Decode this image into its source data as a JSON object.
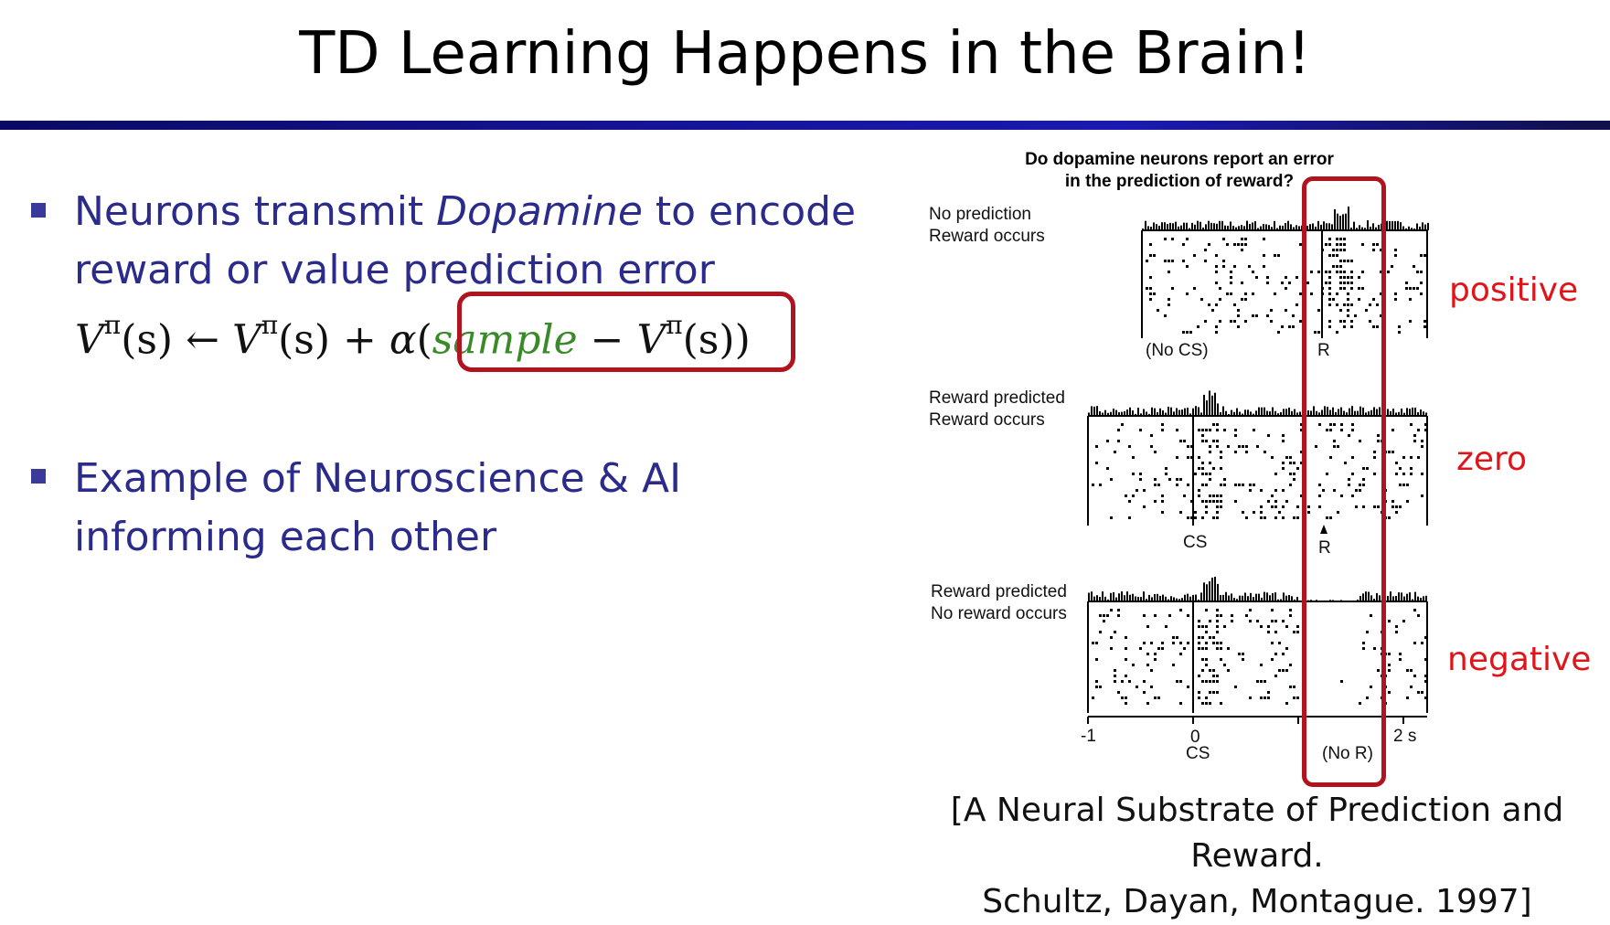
{
  "slide": {
    "title": "TD Learning Happens in the Brain!"
  },
  "bullets": [
    {
      "part1": "Neurons transmit ",
      "emphasis": "Dopamine",
      "part2": " to encode",
      "line2": "reward or value prediction error"
    },
    {
      "line1": "Example of Neuroscience & AI",
      "line2": "informing each other"
    }
  ],
  "equation": {
    "v": "V",
    "pi": "π",
    "s_arg": "(s)",
    "arrow": " ← ",
    "plus": " + ",
    "alpha": "α",
    "open": "(",
    "sample": "sample",
    "minus": " − ",
    "close": ")"
  },
  "figure": {
    "title_line1": "Do dopamine neurons report an error",
    "title_line2": "in the prediction of reward?",
    "panels": [
      {
        "label_line1": "No prediction",
        "label_line2": "Reward occurs",
        "marker_left": "(No CS)",
        "marker_right": "R",
        "error": "positive"
      },
      {
        "label_line1": "Reward predicted",
        "label_line2": "Reward occurs",
        "marker_left": "CS",
        "marker_right": "R",
        "error": "zero"
      },
      {
        "label_line1": "Reward predicted",
        "label_line2": "No reward occurs",
        "marker_left": "",
        "marker_right": "",
        "error": "negative"
      }
    ],
    "axis": {
      "tick_neg1": "-1",
      "tick_0": "0",
      "tick_2": "2 s",
      "cs_label": "CS",
      "no_r_label": "(No R)"
    },
    "colors": {
      "highlight": "#b0141e",
      "error_text": "#e0151a"
    }
  },
  "citation": {
    "line1": "[A Neural Substrate of Prediction and Reward.",
    "line2": "Schultz, Dayan, Montague. 1997]"
  }
}
